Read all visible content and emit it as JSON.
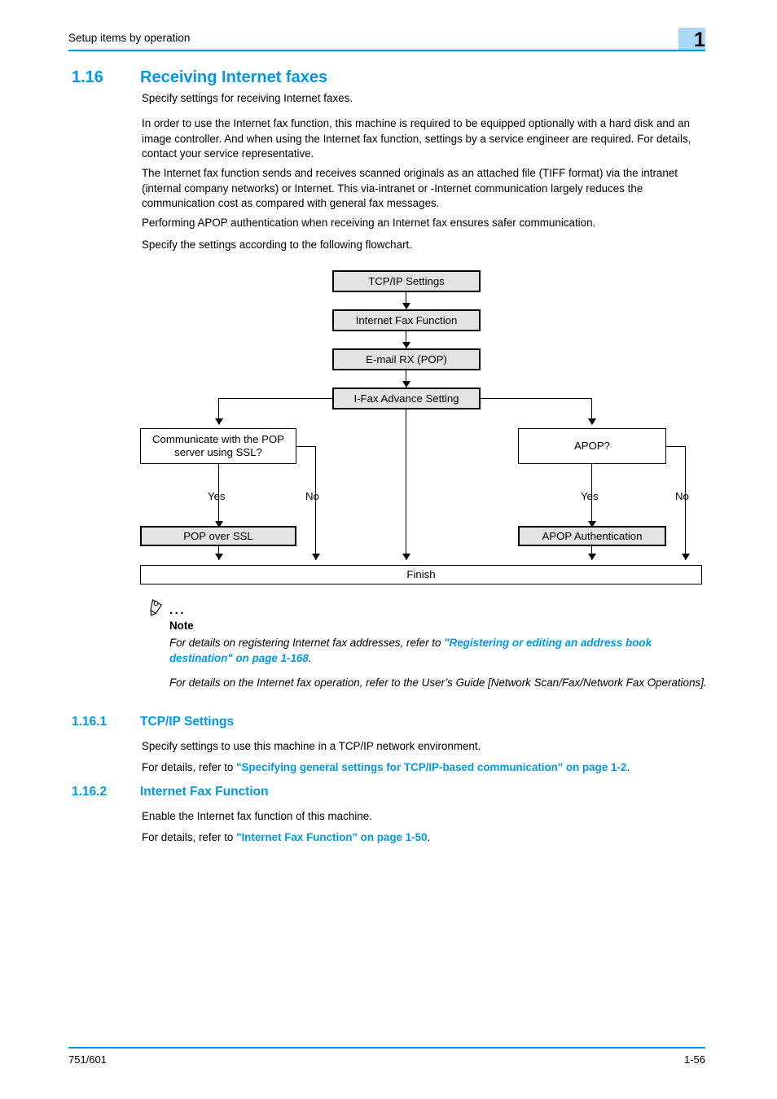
{
  "header": {
    "running_title": "Setup items by operation",
    "chapter_number": "1",
    "badge_color": "#aad8f7",
    "rule_color": "#0098e8"
  },
  "section": {
    "number": "1.16",
    "title": "Receiving Internet faxes",
    "heading_color": "#0098e8"
  },
  "body": {
    "p1": "Specify settings for receiving Internet faxes.",
    "p2": "In order to use the Internet fax function, this machine is required to be equipped optionally with a hard disk and an image controller. And when using the Internet fax function, settings by a service engineer are required. For details, contact your service representative.",
    "p3": "The Internet fax function sends and receives scanned originals as an attached file (TIFF format) via the intranet (internal company networks) or Internet. This via-intranet or -Internet communication largely reduces the communication cost as compared with general fax messages.",
    "p4": "Performing APOP authentication when receiving an Internet fax ensures safer communication.",
    "p5": "Specify the settings according to the following flowchart."
  },
  "flowchart": {
    "boxes": {
      "tcpip": "TCP/IP Settings",
      "ifax_function": "Internet Fax Function",
      "email_rx": "E-mail RX (POP)",
      "ifax_advance": "I-Fax Advance Setting",
      "decision_ssl_line1": "Communicate with the POP",
      "decision_ssl_line2": "server using SSL?",
      "decision_apop": "APOP?",
      "pop_over_ssl": "POP over SSL",
      "apop_auth": "APOP Authentication",
      "finish": "Finish"
    },
    "labels": {
      "ssl_yes": "Yes",
      "ssl_no": "No",
      "apop_yes": "Yes",
      "apop_no": "No"
    }
  },
  "note": {
    "icon": "pencil-icon",
    "dots": "...",
    "label": "Note",
    "para1_pre": "For details on registering Internet fax addresses, refer to ",
    "para1_link": "\"Registering or editing an address book destination\" on page 1-168",
    "para1_post": ".",
    "para2": "For details on the Internet fax operation, refer to the User’s Guide [Network Scan/Fax/Network Fax Operations]."
  },
  "subsections": [
    {
      "number": "1.16.1",
      "title": "TCP/IP Settings",
      "para": "Specify settings to use this machine in a TCP/IP network environment.",
      "ref_pre": "For details, refer to ",
      "ref_link": "\"Specifying general settings for TCP/IP-based communication\" on page 1-2",
      "ref_post": "."
    },
    {
      "number": "1.16.2",
      "title": "Internet Fax Function",
      "para": "Enable the Internet fax function of this machine.",
      "ref_pre": "For details, refer to ",
      "ref_link": "\"Internet Fax Function\" on page 1-50",
      "ref_post": "."
    }
  ],
  "footer": {
    "model": "751/601",
    "page_number": "1-56"
  }
}
